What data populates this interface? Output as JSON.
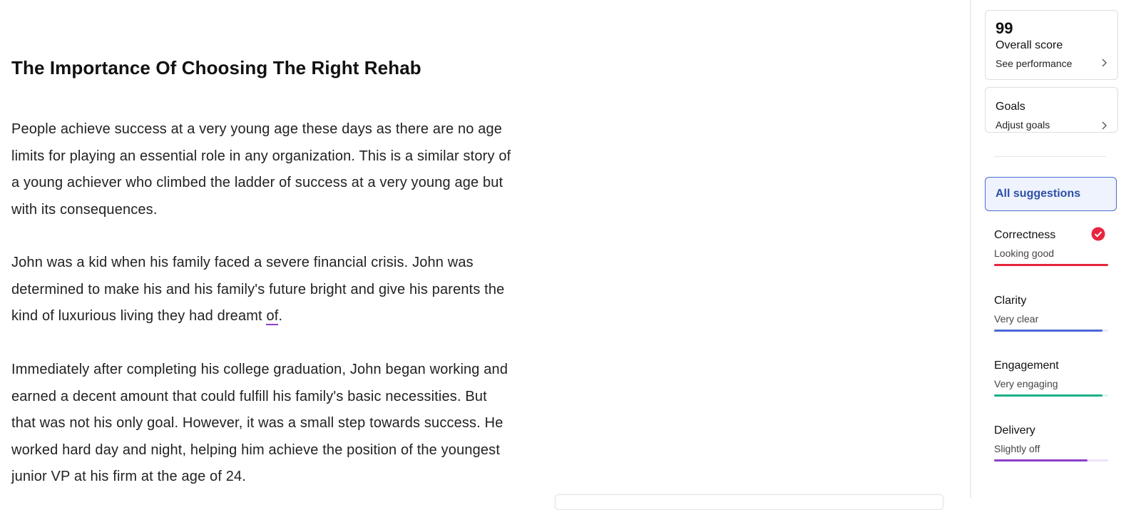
{
  "document": {
    "title": "The Importance Of Choosing The Right Rehab",
    "paragraphs": [
      {
        "text": "People achieve success at a very young age these days as there are no age limits for playing an essential role in any organization. This is a similar story of a young achiever who climbed the ladder of success at a very young age but with its consequences."
      },
      {
        "text_before": "John was a kid when his family faced a severe financial crisis. John was determined to make his and his family's future bright and give his parents the kind of luxurious living they had dreamt ",
        "flagged_word": "of",
        "text_after": "."
      },
      {
        "text": "Immediately after completing his college graduation, John began working and earned a decent amount that could fulfill his family's basic necessities. But that was not his only goal. However, it was a small step towards success. He worked hard day and night, helping him achieve the position of the youngest junior VP at his firm at the age of 24."
      }
    ],
    "flag_color": "#8b3fc9"
  },
  "sidebar": {
    "score": {
      "value": "99",
      "label": "Overall score",
      "link": "See performance",
      "icon": "chevron-right-icon"
    },
    "goals": {
      "label": "Goals",
      "link": "Adjust goals",
      "icon": "chevron-right-icon"
    },
    "all_suggestions": {
      "label": "All suggestions",
      "border_color": "#4a6cd4",
      "background": "#eef3fd"
    },
    "categories": [
      {
        "name": "Correctness",
        "status": "Looking good",
        "level": 1.0,
        "color": "#e8253e",
        "track": "#fde4e7",
        "icon": "check-circle-icon"
      },
      {
        "name": "Clarity",
        "status": "Very clear",
        "level": 0.95,
        "color": "#4a66d8",
        "track": "#e6ebfb"
      },
      {
        "name": "Engagement",
        "status": "Very engaging",
        "level": 0.95,
        "color": "#1cb08a",
        "track": "#ddf4ee"
      },
      {
        "name": "Delivery",
        "status": "Slightly off",
        "level": 0.82,
        "color": "#8b3fc9",
        "track": "#efe3fa"
      }
    ]
  }
}
